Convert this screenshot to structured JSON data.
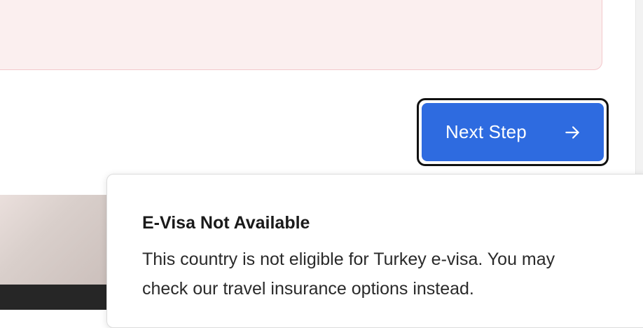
{
  "next_button": {
    "label": "Next Step",
    "icon": "arrow-right-icon"
  },
  "notification": {
    "title": "E-Visa Not Available",
    "message": "This country is not eligible for Turkey e-visa. You may check our travel insurance options instead."
  },
  "colors": {
    "primary_button": "#2e6be0",
    "error_panel_bg": "#fbefef",
    "error_panel_border": "#f3c8cc"
  }
}
